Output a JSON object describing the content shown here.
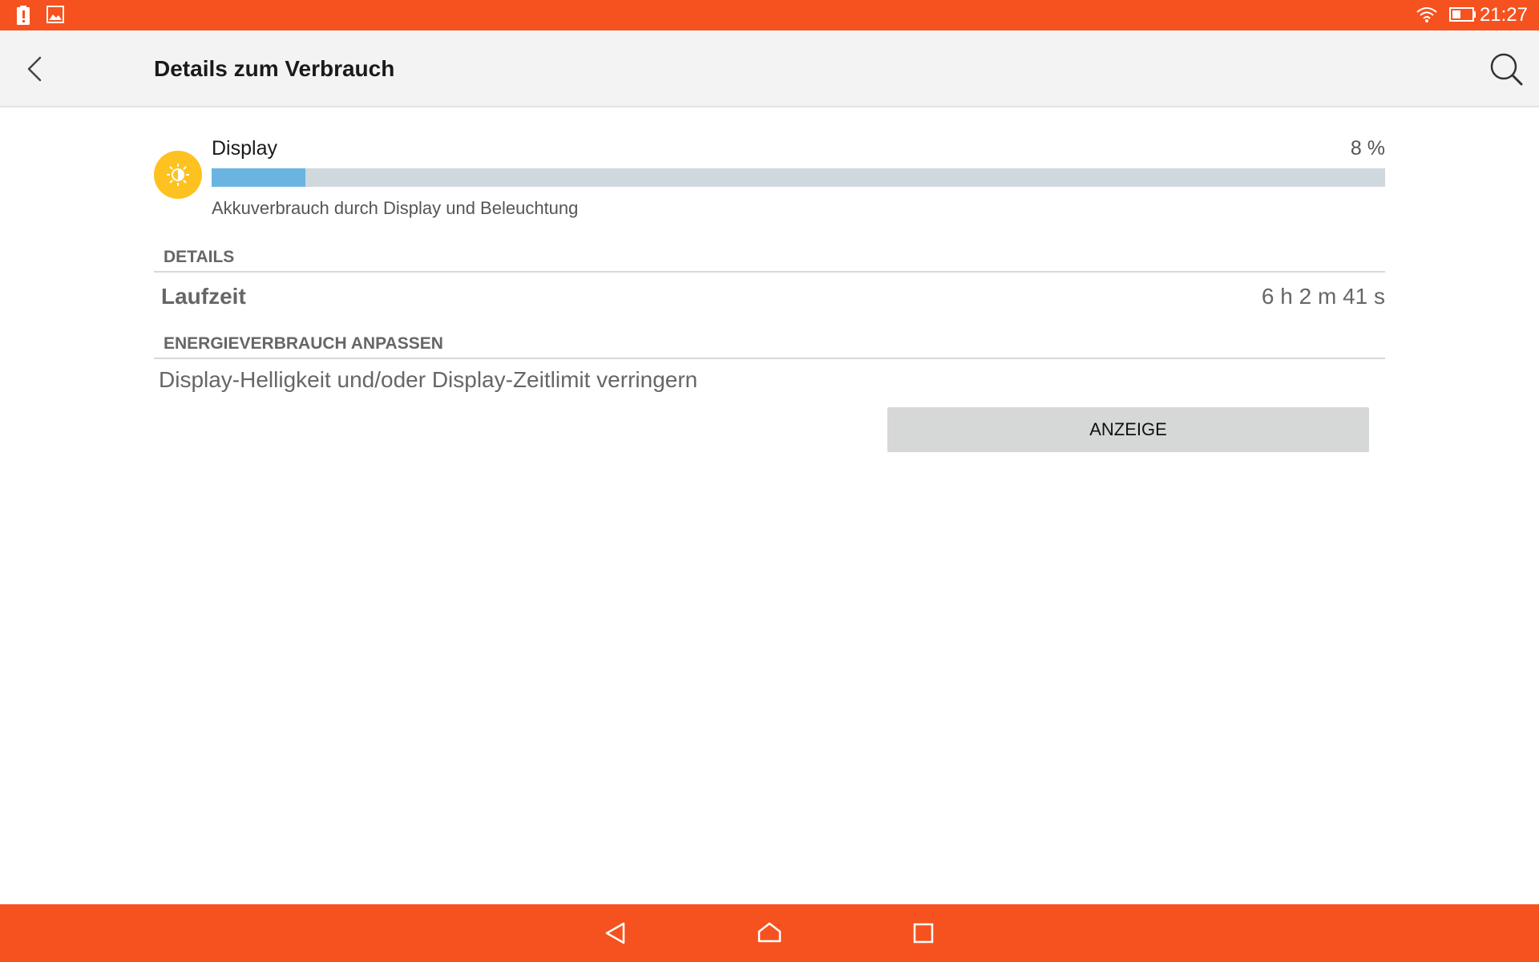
{
  "status_bar": {
    "time": "21:27",
    "left_icons": [
      "battery-alert-icon",
      "image-notification-icon"
    ],
    "right_icons": [
      "wifi-icon",
      "battery-icon"
    ]
  },
  "app_bar": {
    "title": "Details zum Verbrauch",
    "back_icon": "chevron-left-icon",
    "search_icon": "search-icon"
  },
  "usage": {
    "icon": "brightness-icon",
    "name": "Display",
    "percent_label": "8 %",
    "percent_value": 8,
    "description": "Akkuverbrauch durch Display und Beleuchtung"
  },
  "details": {
    "header": "DETAILS",
    "runtime_label": "Laufzeit",
    "runtime_value": "6 h 2 m 41 s"
  },
  "adjust": {
    "header": "ENERGIEVERBRAUCH ANPASSEN",
    "tip": "Display-Helligkeit und/oder Display-Zeitlimit verringern",
    "button_label": "ANZEIGE"
  },
  "nav_bar": {
    "icons": [
      "nav-back-icon",
      "nav-home-icon",
      "nav-recents-icon"
    ]
  },
  "colors": {
    "accent": "#f5521f",
    "progress_fill": "#6ab4e2",
    "progress_track": "#cfd8dc",
    "usage_icon_bg": "#fdc21f",
    "app_bar_bg": "#f3f3f3",
    "button_bg": "#d6d8d8"
  }
}
